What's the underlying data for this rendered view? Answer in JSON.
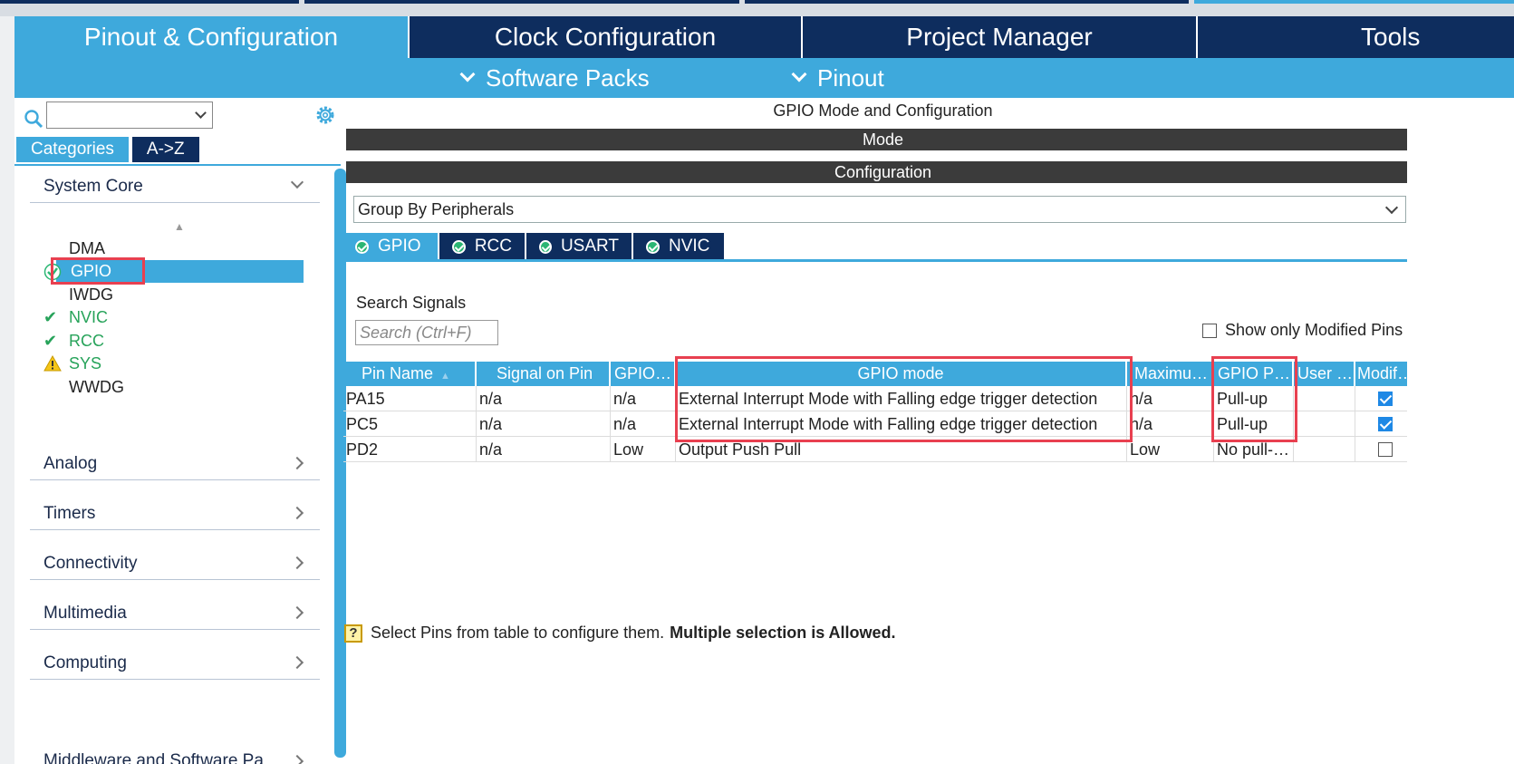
{
  "tabs": [
    {
      "label": "Pinout & Configuration",
      "active": true
    },
    {
      "label": "Clock Configuration",
      "active": false
    },
    {
      "label": "Project Manager",
      "active": false
    },
    {
      "label": "Tools",
      "active": false
    }
  ],
  "subbar": {
    "software_packs": "Software Packs",
    "pinout": "Pinout"
  },
  "left": {
    "category_tabs": {
      "categories": "Categories",
      "az": "A->Z"
    },
    "system_core": {
      "label": "System Core",
      "items": [
        {
          "label": "DMA",
          "status": "none"
        },
        {
          "label": "GPIO",
          "status": "selected"
        },
        {
          "label": "IWDG",
          "status": "none"
        },
        {
          "label": "NVIC",
          "status": "ok"
        },
        {
          "label": "RCC",
          "status": "ok"
        },
        {
          "label": "SYS",
          "status": "warning"
        },
        {
          "label": "WWDG",
          "status": "none"
        }
      ]
    },
    "categories": [
      "Analog",
      "Timers",
      "Connectivity",
      "Multimedia",
      "Computing",
      "Middleware and Software Pa"
    ]
  },
  "right": {
    "title": "GPIO Mode and Configuration",
    "mode_bar": "Mode",
    "config_bar": "Configuration",
    "group_by": "Group By Peripherals",
    "peripheral_tabs": [
      "GPIO",
      "RCC",
      "USART",
      "NVIC"
    ],
    "search_label": "Search Signals",
    "search_placeholder": "Search (Ctrl+F)",
    "show_modified": "Show only Modified Pins",
    "table": {
      "headers": [
        "Pin Name",
        "Signal on Pin",
        "GPIO…",
        "GPIO mode",
        "Maximu…",
        "GPIO P…",
        "User …",
        "Modif…"
      ],
      "rows": [
        {
          "pin": "PA15",
          "signal": "n/a",
          "output": "n/a",
          "mode": "External Interrupt Mode with Falling edge trigger detection",
          "speed": "n/a",
          "pull": "Pull-up",
          "user": "",
          "modified": true
        },
        {
          "pin": "PC5",
          "signal": "n/a",
          "output": "n/a",
          "mode": "External Interrupt Mode with Falling edge trigger detection",
          "speed": "n/a",
          "pull": "Pull-up",
          "user": "",
          "modified": true
        },
        {
          "pin": "PD2",
          "signal": "n/a",
          "output": "Low",
          "mode": "Output Push Pull",
          "speed": "Low",
          "pull": "No pull-…",
          "user": "",
          "modified": false
        }
      ]
    },
    "hint": {
      "normal": "Select Pins from table to configure them.",
      "bold": "Multiple selection is Allowed."
    }
  },
  "colors": {
    "navy": "#0e2d5e",
    "accent": "#3ea9dc",
    "highlight": "#e84050",
    "ok": "#27a35a"
  }
}
